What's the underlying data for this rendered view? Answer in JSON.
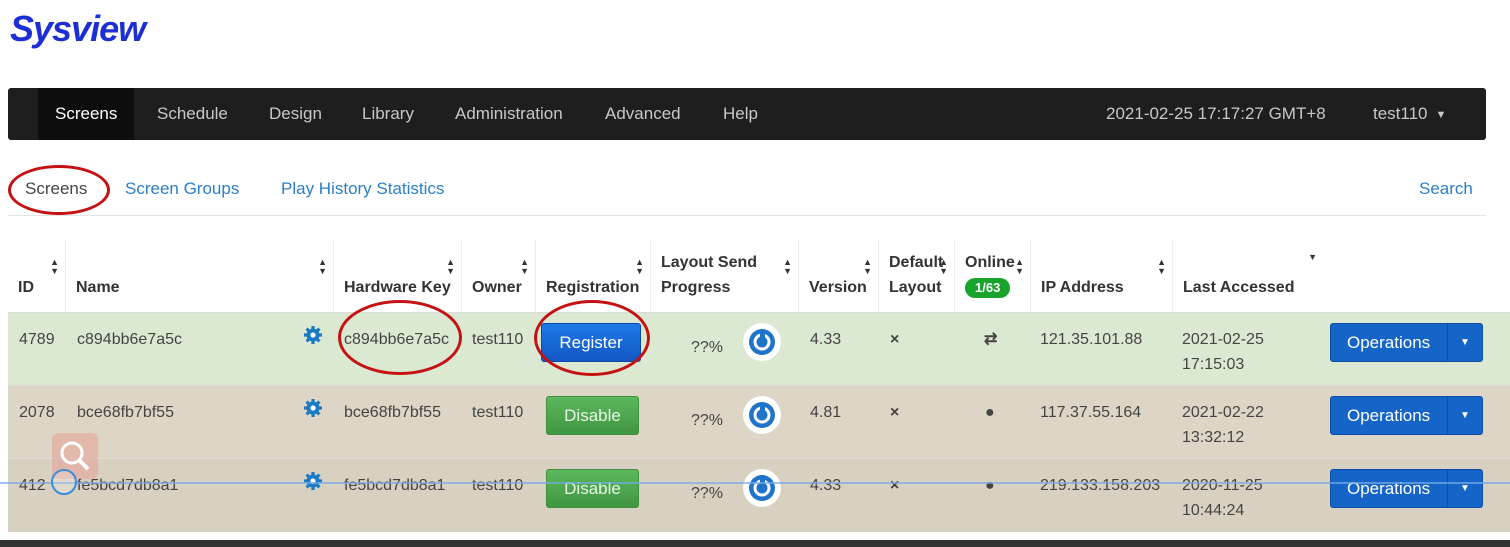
{
  "app": {
    "brand": "Sysview"
  },
  "nav": {
    "items": [
      "Screens",
      "Schedule",
      "Design",
      "Library",
      "Administration",
      "Advanced",
      "Help"
    ],
    "active": "Screens",
    "datetime": "2021-02-25 17:17:27 GMT+8",
    "user": "test110"
  },
  "subtabs": {
    "items": [
      "Screens",
      "Screen Groups",
      "Play History Statistics"
    ],
    "active": "Screens",
    "search": "Search"
  },
  "table": {
    "headers": {
      "id": "ID",
      "name": "Name",
      "hardware_key": "Hardware Key",
      "owner": "Owner",
      "registration": "Registration",
      "layout_send_progress_1": "Layout Send",
      "layout_send_progress_2": "Progress",
      "version": "Version",
      "default_layout_1": "Default",
      "default_layout_2": "Layout",
      "online": "Online",
      "online_badge": "1/63",
      "ip_address": "IP Address",
      "last_accessed": "Last Accessed"
    },
    "rows": [
      {
        "id": "4789",
        "name": "c894bb6e7a5c",
        "hardware_key": "c894bb6e7a5c",
        "owner": "test110",
        "registration": "Register",
        "progress": "??%",
        "version": "4.33",
        "default_layout": "×",
        "online_icon": "⇄",
        "ip": "121.35.101.88",
        "last_date": "2021-02-25",
        "last_time": "17:15:03",
        "operations": "Operations",
        "status_color": "#dbe9d3"
      },
      {
        "id": "2078",
        "name": "bce68fb7bf55",
        "hardware_key": "bce68fb7bf55",
        "owner": "test110",
        "registration": "Disable",
        "progress": "??%",
        "version": "4.81",
        "default_layout": "×",
        "online_icon": "●",
        "ip": "117.37.55.164",
        "last_date": "2021-02-22",
        "last_time": "13:32:12",
        "operations": "Operations",
        "status_color": "#ddd5c5"
      },
      {
        "id": "412",
        "name": "fe5bcd7db8a1",
        "hardware_key": "fe5bcd7db8a1",
        "owner": "test110",
        "registration": "Disable",
        "progress": "??%",
        "version": "4.33",
        "default_layout": "×",
        "online_icon": "●",
        "ip": "219.133.158.203",
        "last_date": "2020-11-25",
        "last_time": "10:44:24",
        "operations": "Operations",
        "status_color": "#d8d1c1"
      }
    ]
  },
  "colors": {
    "brand": "#1c2fd4",
    "navbar": "#1e1e1e",
    "link": "#2a7fc9",
    "register": "#1257c3",
    "disable": "#419641",
    "operations": "#1565c8",
    "annotation": "#c41212"
  }
}
